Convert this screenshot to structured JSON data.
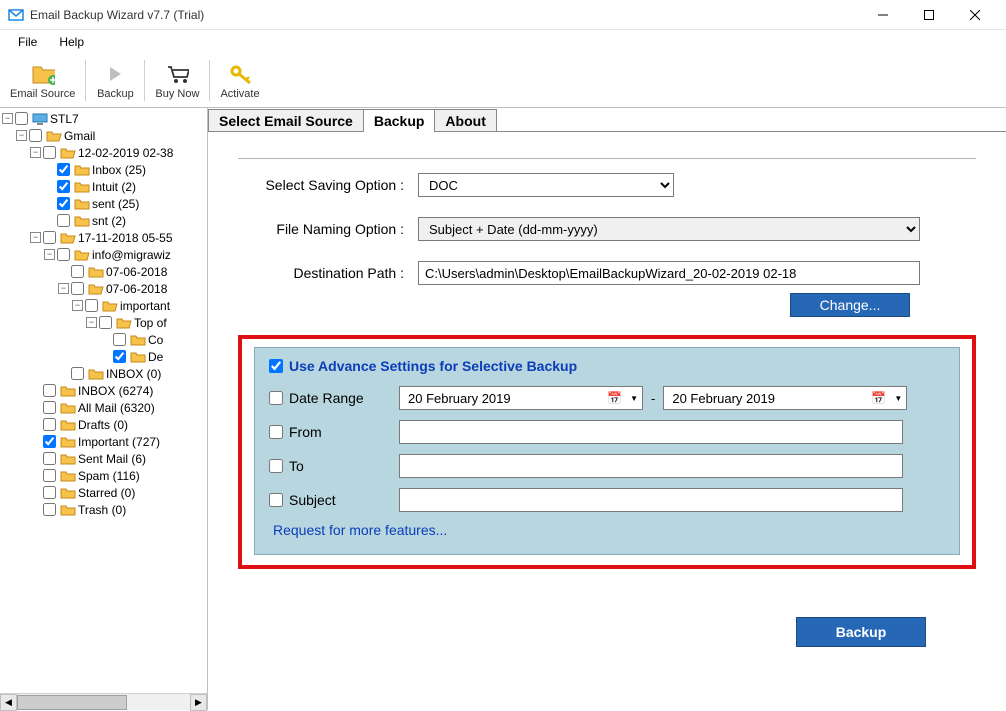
{
  "window": {
    "title": "Email Backup Wizard v7.7 (Trial)"
  },
  "menu": {
    "file": "File",
    "help": "Help"
  },
  "toolbar": {
    "email_source": "Email Source",
    "backup": "Backup",
    "buy_now": "Buy Now",
    "activate": "Activate"
  },
  "tree": {
    "root": "STL7",
    "gmail": "Gmail",
    "n12": "12-02-2019 02-38",
    "inbox25": "Inbox (25)",
    "intuit2": "Intuit (2)",
    "sent25": "sent (25)",
    "snt2": "snt (2)",
    "n17": "17-11-2018 05-55",
    "info": "info@migrawiz",
    "d0706a": "07-06-2018",
    "d0706b": "07-06-2018",
    "important": "important",
    "topc": "Top of",
    "co": "Co",
    "de": "De",
    "inbox0": "INBOX (0)",
    "inbox6274": "INBOX (6274)",
    "allmail": "All Mail (6320)",
    "drafts": "Drafts (0)",
    "important727": "Important (727)",
    "sentmail": "Sent Mail (6)",
    "spam": "Spam (116)",
    "starred": "Starred (0)",
    "trash": "Trash (0)"
  },
  "tabs": {
    "t1": "Select Email Source",
    "t2": "Backup",
    "t3": "About"
  },
  "form": {
    "saving_label": "Select Saving Option :",
    "saving_value": "DOC",
    "naming_label": "File Naming Option :",
    "naming_value": "Subject + Date (dd-mm-yyyy)",
    "path_label": "Destination Path :",
    "path_value": "C:\\Users\\admin\\Desktop\\EmailBackupWizard_20-02-2019 02-18",
    "change_btn": "Change..."
  },
  "adv": {
    "title": "Use Advance Settings for Selective Backup",
    "date_range": "Date Range",
    "date_value": "20   February   2019",
    "from": "From",
    "to": "To",
    "subject": "Subject",
    "request": "Request for more features..."
  },
  "backup_btn": "Backup"
}
